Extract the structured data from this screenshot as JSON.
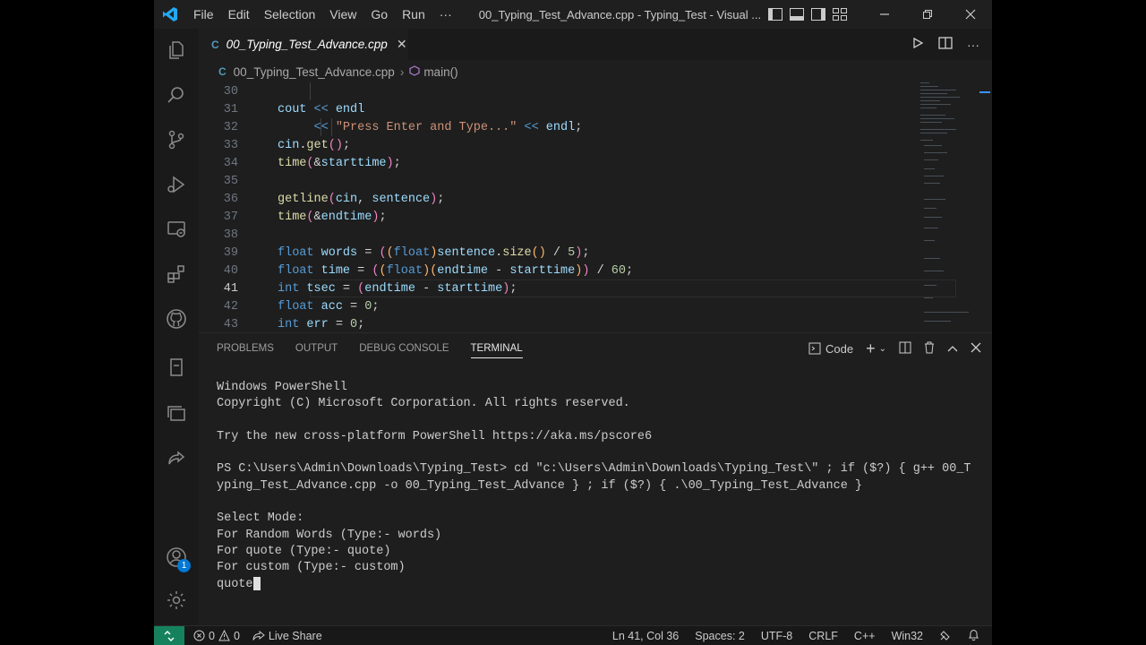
{
  "menu": [
    "File",
    "Edit",
    "Selection",
    "View",
    "Go",
    "Run",
    "···"
  ],
  "window_title": "00_Typing_Test_Advance.cpp - Typing_Test - Visual ...",
  "tab": {
    "label": "00_Typing_Test_Advance.cpp",
    "icon": "C",
    "close": "✕"
  },
  "breadcrumb": {
    "file": "00_Typing_Test_Advance.cpp",
    "symbol": "main()"
  },
  "activity_icons": [
    "explorer-icon",
    "search-icon",
    "source-control-icon",
    "run-debug-icon",
    "remote-explorer-icon",
    "extensions-icon",
    "github-icon",
    "notebook-icon",
    "copy-icon",
    "live-share-icon"
  ],
  "account_badge": "1",
  "code_lines": [
    {
      "n": "30",
      "text": ""
    },
    {
      "n": "31",
      "text": "cout << endl"
    },
    {
      "n": "32",
      "text": "     << \"Press Enter and Type...\" << endl;"
    },
    {
      "n": "33",
      "text": "cin.get();"
    },
    {
      "n": "34",
      "text": "time(&starttime);"
    },
    {
      "n": "35",
      "text": ""
    },
    {
      "n": "36",
      "text": "getline(cin, sentence);"
    },
    {
      "n": "37",
      "text": "time(&endtime);"
    },
    {
      "n": "38",
      "text": ""
    },
    {
      "n": "39",
      "text": "float words = ((float)sentence.size() / 5);"
    },
    {
      "n": "40",
      "text": "float time = ((float)(endtime - starttime)) / 60;"
    },
    {
      "n": "41",
      "text": "int tsec = (endtime - starttime);"
    },
    {
      "n": "42",
      "text": "float acc = 0;"
    },
    {
      "n": "43",
      "text": "int err = 0;"
    }
  ],
  "panel": {
    "tabs": [
      "PROBLEMS",
      "OUTPUT",
      "DEBUG CONSOLE",
      "TERMINAL"
    ],
    "selected_tab": "TERMINAL",
    "terminal_name": "Code",
    "terminal_lines": [
      "Windows PowerShell",
      "Copyright (C) Microsoft Corporation. All rights reserved.",
      "",
      "Try the new cross-platform PowerShell https://aka.ms/pscore6",
      "",
      "PS C:\\Users\\Admin\\Downloads\\Typing_Test> cd \"c:\\Users\\Admin\\Downloads\\Typing_Test\\\" ; if ($?) { g++ 00_T",
      "yping_Test_Advance.cpp -o 00_Typing_Test_Advance } ; if ($?) { .\\00_Typing_Test_Advance }",
      "",
      "Select Mode:",
      "For Random Words (Type:- words)",
      "For quote (Type:- quote)",
      "For custom (Type:- custom)",
      "quote"
    ]
  },
  "status": {
    "errors": "0",
    "warnings": "0",
    "live_share": "Live Share",
    "position": "Ln 41, Col 36",
    "spaces": "Spaces: 2",
    "encoding": "UTF-8",
    "eol": "CRLF",
    "language": "C++",
    "platform": "Win32"
  },
  "colors": {
    "accent": "#3794ff",
    "remote": "#16825d",
    "background": "#1e1e1e"
  }
}
